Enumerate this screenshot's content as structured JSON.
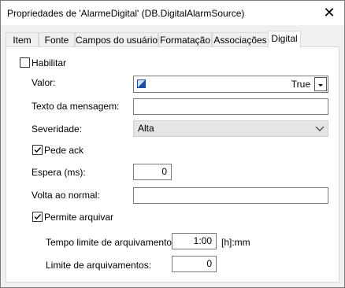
{
  "window": {
    "title": "Propriedades de 'AlarmeDigital' (DB.DigitalAlarmSource)",
    "close_glyph": "✕"
  },
  "tabs": [
    {
      "label": "Item"
    },
    {
      "label": "Fonte"
    },
    {
      "label": "Campos do usuário"
    },
    {
      "label": "Formatação"
    },
    {
      "label": "Associações"
    },
    {
      "label": "Digital",
      "active": true
    }
  ],
  "form": {
    "habilitar": {
      "label": "Habilitar",
      "checked": false
    },
    "valor": {
      "label": "Valor:",
      "value": "True",
      "icon": "value-type-icon"
    },
    "texto_mensagem": {
      "label": "Texto da mensagem:",
      "value": ""
    },
    "severidade": {
      "label": "Severidade:",
      "value": "Alta"
    },
    "pede_ack": {
      "label": "Pede ack",
      "checked": true
    },
    "espera": {
      "label": "Espera (ms):",
      "value": "0"
    },
    "volta_normal": {
      "label": "Volta ao normal:",
      "value": ""
    },
    "permite_arquivar": {
      "label": "Permite arquivar",
      "checked": true
    },
    "tempo_limite": {
      "label": "Tempo limite de arquivamento:",
      "value": "1:00",
      "unit": "[h]:mm"
    },
    "limite_arquivamentos": {
      "label": "Limite de arquivamentos:",
      "value": "0"
    }
  },
  "colors": {
    "window_bg": "#f0f0f0",
    "panel_bg": "#ffffff",
    "combo_bg": "#e5e5e5",
    "icon_blue": "#1f4e9a"
  }
}
